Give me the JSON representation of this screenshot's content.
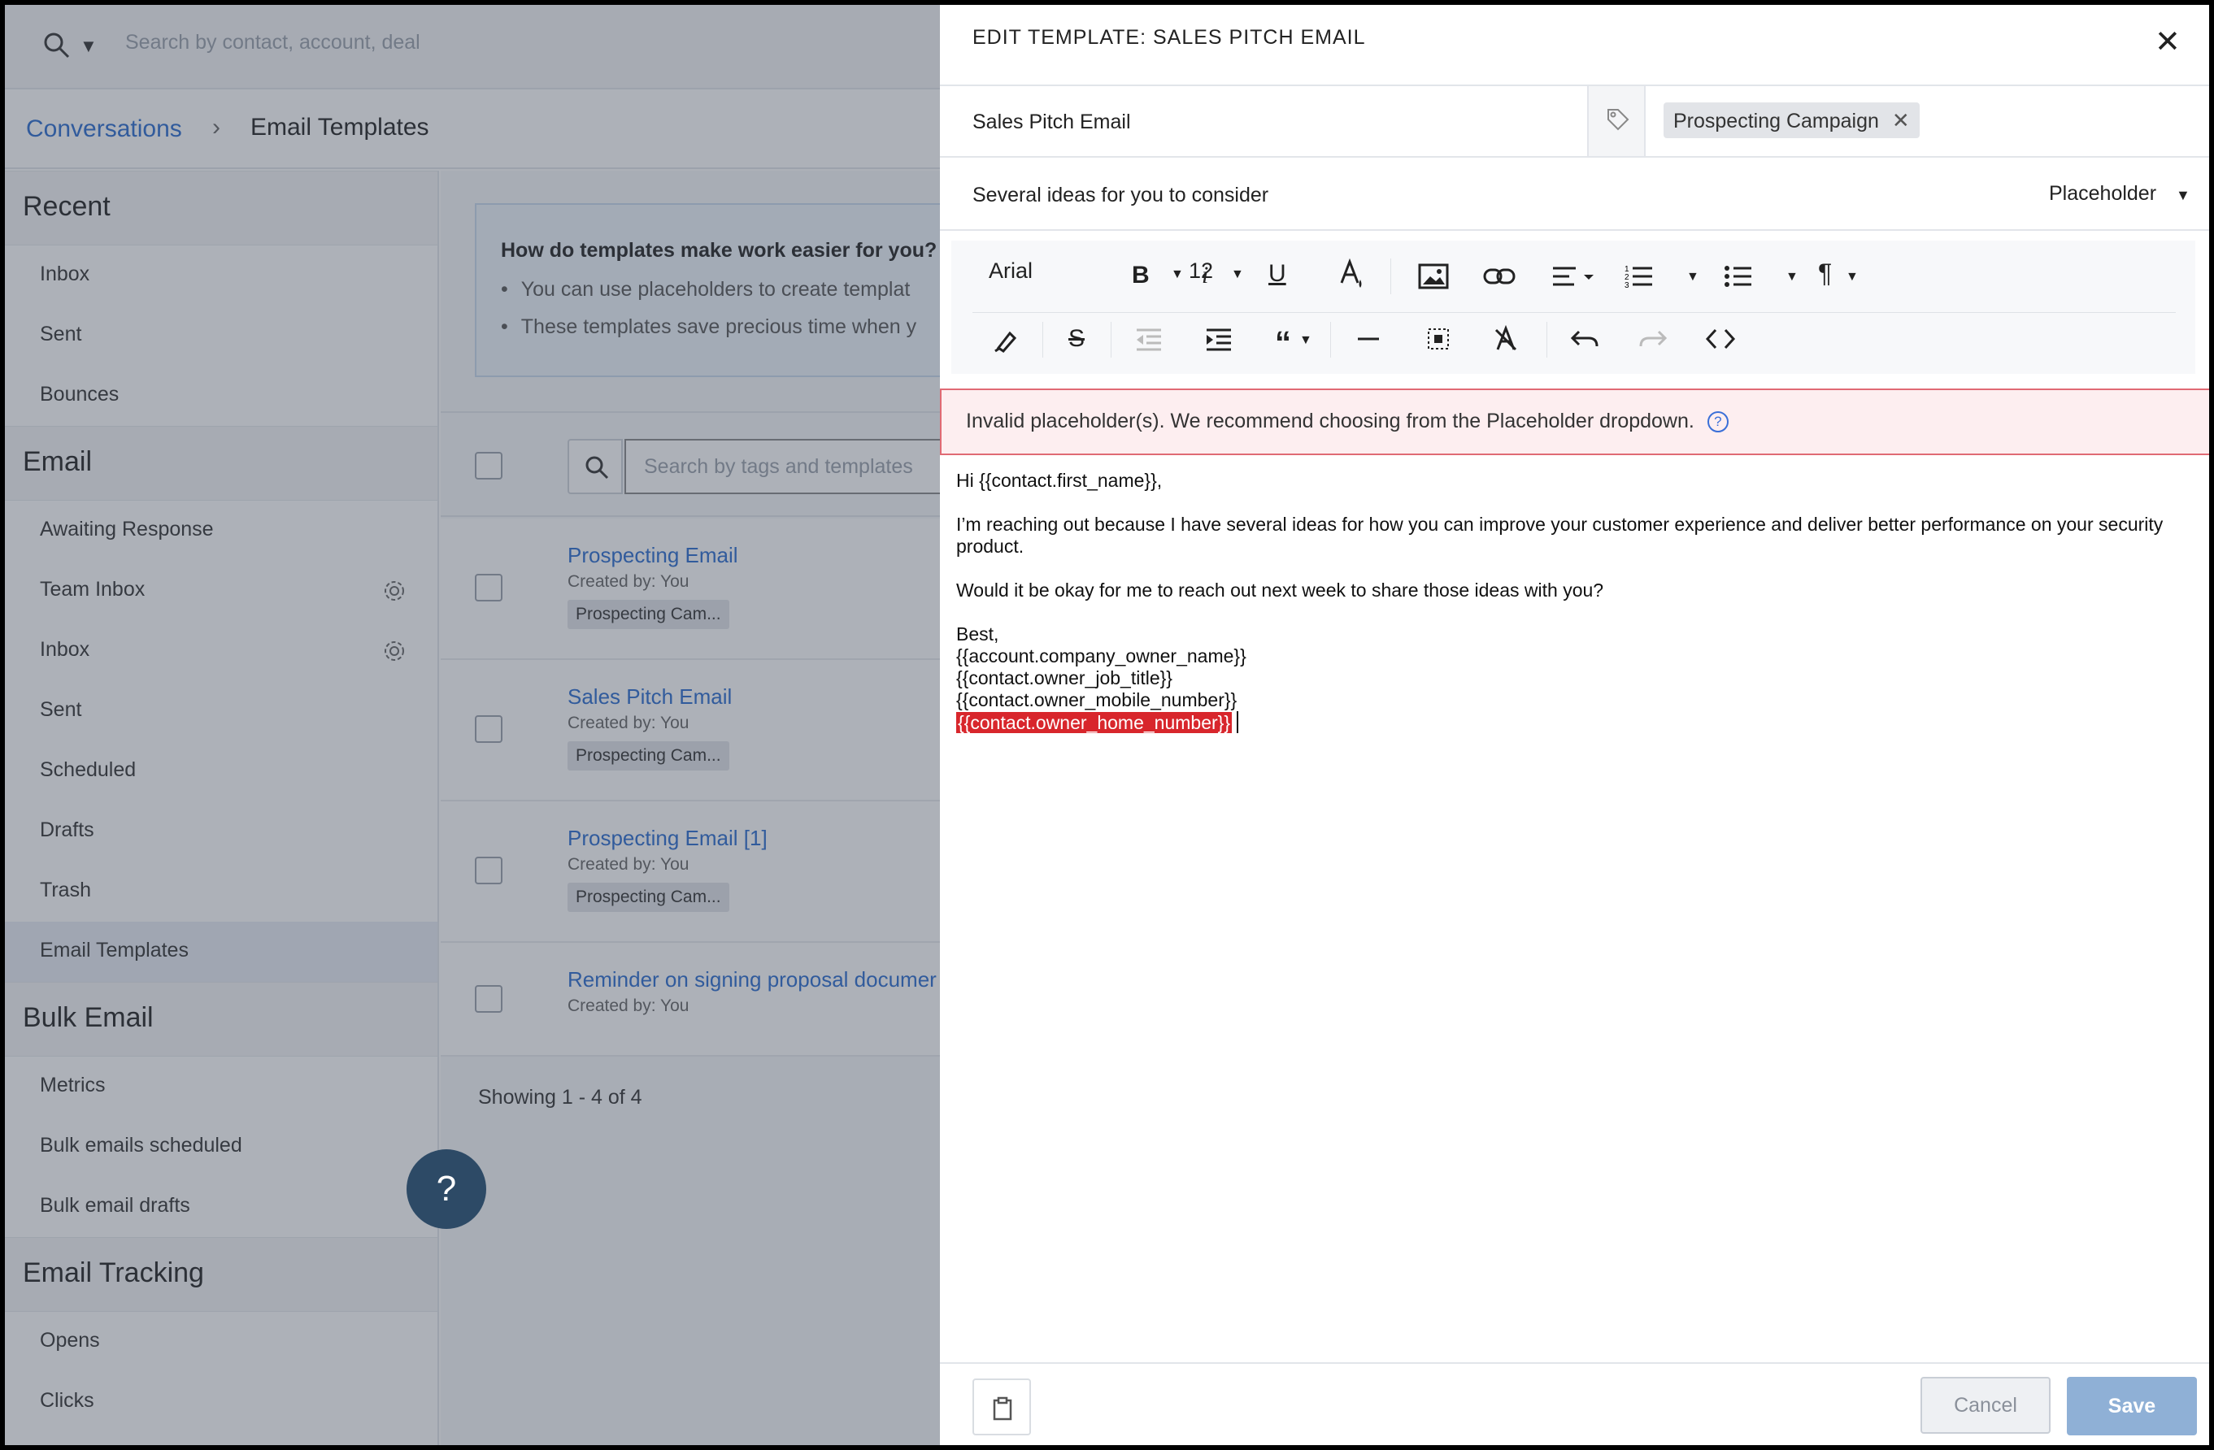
{
  "topbar": {
    "search_placeholder": "Search by contact, account, deal"
  },
  "breadcrumb": {
    "parent": "Conversations",
    "separator": "›",
    "current": "Email Templates"
  },
  "sidebar": {
    "sections": [
      {
        "title": "Recent",
        "items": [
          {
            "label": "Inbox"
          },
          {
            "label": "Sent"
          },
          {
            "label": "Bounces"
          }
        ]
      },
      {
        "title": "Email",
        "items": [
          {
            "label": "Awaiting Response"
          },
          {
            "label": "Team Inbox",
            "icon": "gear-icon"
          },
          {
            "label": "Inbox",
            "icon": "gear-icon"
          },
          {
            "label": "Sent"
          },
          {
            "label": "Scheduled"
          },
          {
            "label": "Drafts"
          },
          {
            "label": "Trash"
          },
          {
            "label": "Email Templates",
            "active": true
          }
        ]
      },
      {
        "title": "Bulk Email",
        "items": [
          {
            "label": "Metrics"
          },
          {
            "label": "Bulk emails scheduled"
          },
          {
            "label": "Bulk email drafts"
          }
        ]
      },
      {
        "title": "Email Tracking",
        "items": [
          {
            "label": "Opens"
          },
          {
            "label": "Clicks"
          }
        ]
      }
    ]
  },
  "info": {
    "question": "How do templates make work easier for you?",
    "bullets": [
      "You can use placeholders to create templat",
      "These templates save precious time when y"
    ]
  },
  "templates": {
    "search_placeholder": "Search by tags and templates",
    "rows": [
      {
        "name": "Prospecting Email",
        "created_by": "Created by: You",
        "tag": "Prospecting Cam..."
      },
      {
        "name": "Sales Pitch Email",
        "created_by": "Created by: You",
        "tag": "Prospecting Cam..."
      },
      {
        "name": "Prospecting Email [1]",
        "created_by": "Created by: You",
        "tag": "Prospecting Cam..."
      },
      {
        "name": "Reminder on signing proposal documer",
        "created_by": "Created by: You",
        "tag": ""
      }
    ],
    "showing": "Showing 1 - 4 of 4"
  },
  "help": {
    "label": "?"
  },
  "panel": {
    "title": "EDIT TEMPLATE: SALES PITCH EMAIL",
    "close": "✕",
    "name": "Sales Pitch Email",
    "tag_chip": "Prospecting Campaign",
    "tag_remove": "✕",
    "subject": "Several ideas for you to consider",
    "placeholder_dropdown": "Placeholder",
    "toolbar": {
      "font": "Arial",
      "size": "12"
    },
    "alert": "Invalid placeholder(s). We recommend choosing from the Placeholder dropdown.",
    "alert_help": "?",
    "body": {
      "greeting": "Hi {{contact.first_name}},",
      "para1": "I’m reaching out because I have several ideas for how you can improve your customer experience and deliver better performance on your security product.",
      "para2": "Would it be okay for me to reach out next week to share those ideas with you?",
      "signoff": "Best,",
      "sig1": "{{account.company_owner_name}}",
      "sig2": "{{contact.owner_job_title}}",
      "sig3": "{{contact.owner_mobile_number}}",
      "sig_invalid": "{{contact.owner_home_number}}"
    },
    "footer": {
      "cancel": "Cancel",
      "save": "Save"
    }
  },
  "colors": {
    "link": "#2a6ccf",
    "invalid": "#d8262c",
    "alert_bg": "#fdeef0",
    "save": "#8fb0d6",
    "help_btn": "#2d4a66"
  }
}
